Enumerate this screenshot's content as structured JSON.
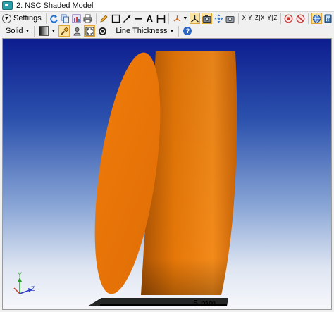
{
  "window": {
    "title": "2: NSC Shaded Model"
  },
  "toolbar1": {
    "settings_label": "Settings",
    "text_tool_label": "A",
    "axis_x_label": "X|Y",
    "axis_z_label": "Z|X",
    "axis_y_label": "Y|Z"
  },
  "toolbar2": {
    "render_mode_label": "Solid",
    "line_thickness_label": "Line Thickness",
    "help_label": "?"
  },
  "viewport": {
    "scale_text": "5 mm",
    "axis_triad": {
      "y_label": "Y",
      "z_label": "Z"
    },
    "colors": {
      "body": "#e8780c",
      "body_dark": "#b85a05",
      "face": "#f07c0a",
      "bg_top": "#0d1d8f"
    }
  }
}
